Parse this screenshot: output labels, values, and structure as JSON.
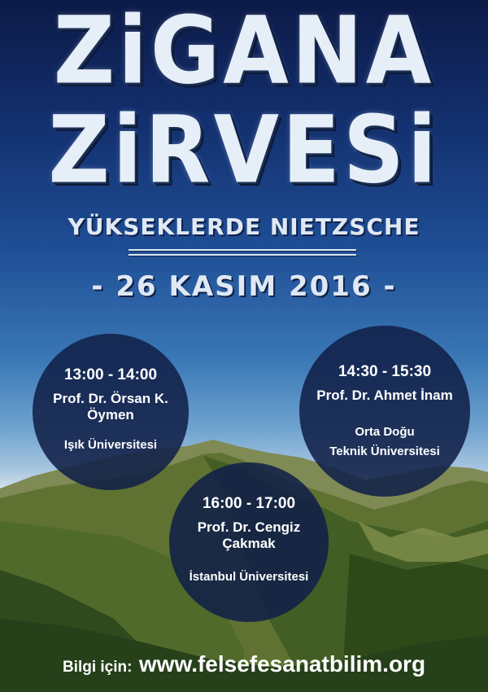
{
  "poster": {
    "title_line1": "ZiGANA",
    "title_line2": "ZiRVESi",
    "subtitle": "YÜKSEKLERDE NIETZSCHE",
    "date": "- 26 KASIM 2016 -"
  },
  "sessions": [
    {
      "time": "13:00 - 14:00",
      "speaker": "Prof. Dr. Örsan K. Öymen",
      "institution": "Işık Üniversitesi"
    },
    {
      "time": "14:30 - 15:30",
      "speaker": "Prof. Dr. Ahmet İnam",
      "institution_line1": "Orta Doğu",
      "institution_line2": "Teknik Üniversitesi"
    },
    {
      "time": "16:00 - 17:00",
      "speaker": "Prof. Dr. Cengiz Çakmak",
      "institution": "İstanbul Üniversitesi"
    }
  ],
  "footer": {
    "label": "Bilgi için:",
    "url": "www.felsefesanatbilim.org"
  },
  "colors": {
    "sky_top": "#0c1a47",
    "sky_mid": "#3a78b6",
    "circle_fill": "#112048",
    "mountain_dark": "#2f4f22",
    "mountain_light": "#7f8f4a"
  }
}
